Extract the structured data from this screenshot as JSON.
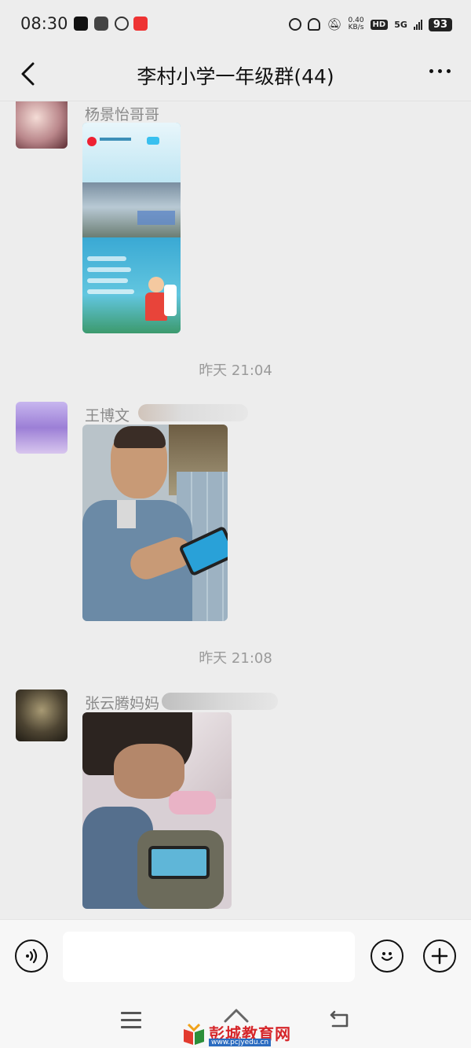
{
  "status_bar": {
    "time": "08:30",
    "net_speed_value": "0.40",
    "net_speed_unit": "KB/s",
    "hd_label": "HD",
    "signal_label": "5G",
    "battery": "93"
  },
  "header": {
    "title": "李村小学一年级群(44)",
    "back_icon": "chevron-left-icon",
    "more_icon": "more-dots-icon"
  },
  "messages": [
    {
      "sender": "杨景怡哥哥",
      "type": "image",
      "image": "phone-screenshot-kids-event"
    },
    {
      "timestamp": "昨天 21:04"
    },
    {
      "sender": "王博文",
      "type": "image",
      "image": "photo-boy-with-phone"
    },
    {
      "timestamp": "昨天 21:08"
    },
    {
      "sender": "张云腾妈妈",
      "type": "image",
      "image": "photo-boy-playing-phone"
    }
  ],
  "composer": {
    "voice_icon": "voice-icon",
    "input_value": "",
    "emoji_icon": "emoji-icon",
    "plus_icon": "plus-icon"
  },
  "system_nav": {
    "menu_icon": "menu-icon",
    "home_icon": "home-icon",
    "back_icon": "back-icon"
  },
  "watermark": {
    "name": "彭城教育网",
    "url": "www.pcjyedu.cn"
  },
  "colors": {
    "background": "#ededed",
    "composer": "#f7f7f7",
    "watermark_red": "#d6262a",
    "watermark_blue": "#2b6cc0"
  }
}
